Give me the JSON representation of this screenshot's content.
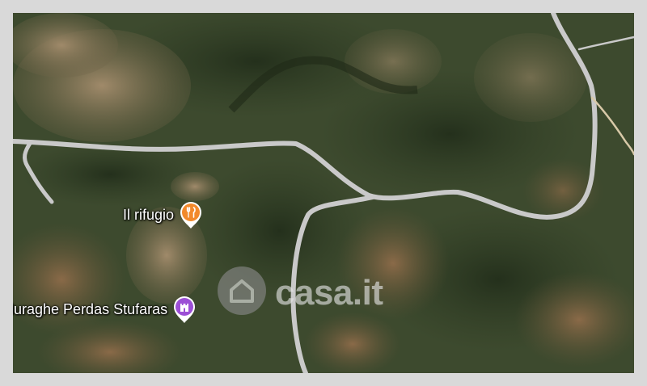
{
  "map": {
    "type": "satellite",
    "pois": [
      {
        "label": "Il rifugio",
        "icon": "restaurant-icon",
        "color": "#f2892b"
      },
      {
        "label": "Nuraghe Perdas Stufaras",
        "icon": "castle-icon",
        "color": "#9c4fd6"
      }
    ],
    "road_color": "#c9c9c9"
  },
  "watermark": {
    "text": "casa.it",
    "icon": "house-icon"
  }
}
